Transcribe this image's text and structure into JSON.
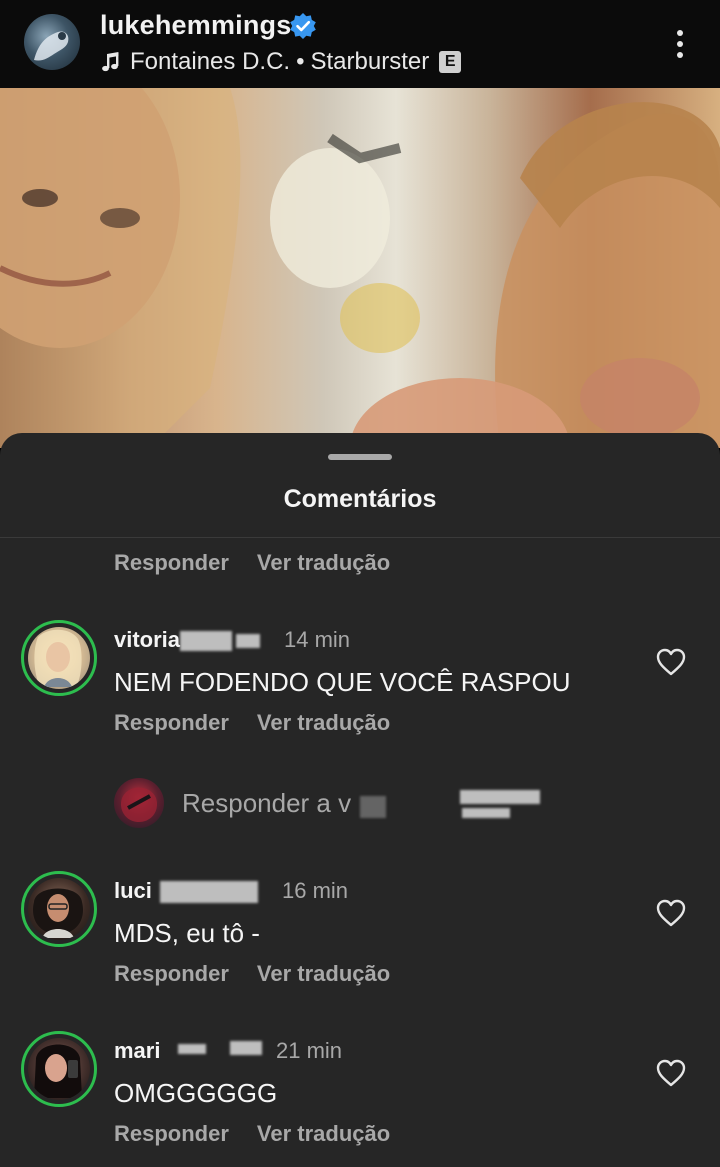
{
  "header": {
    "username": "lukehemmings",
    "music": {
      "artist": "Fontaines D.C.",
      "separator": "•",
      "track": "Starburster",
      "explicit_badge": "E"
    },
    "icons": {
      "verified": "verified-badge-icon",
      "music": "music-note-icon",
      "more": "more-vertical-icon"
    }
  },
  "sheet": {
    "title": "Comentários",
    "top_actions": {
      "reply": "Responder",
      "translate": "Ver tradução"
    }
  },
  "comments": [
    {
      "username": "vitoria",
      "time": "14 min",
      "text": "NEM FODENDO QUE VOCÊ RASPOU",
      "reply_label": "Responder",
      "translate_label": "Ver tradução"
    },
    {
      "username": "luci",
      "time": "16 min",
      "text": "MDS, eu tô -",
      "reply_label": "Responder",
      "translate_label": "Ver tradução"
    },
    {
      "username": "mari",
      "time": "21 min",
      "text": "OMGGGGGG",
      "reply_label": "Responder",
      "translate_label": "Ver tradução"
    }
  ],
  "reply_prompt": {
    "placeholder": "Responder a v"
  },
  "colors": {
    "sheet_background": "#262626",
    "story_ring": "#2dbd4e",
    "secondary_text": "#a8a8a8",
    "verified_blue": "#3897f0"
  }
}
